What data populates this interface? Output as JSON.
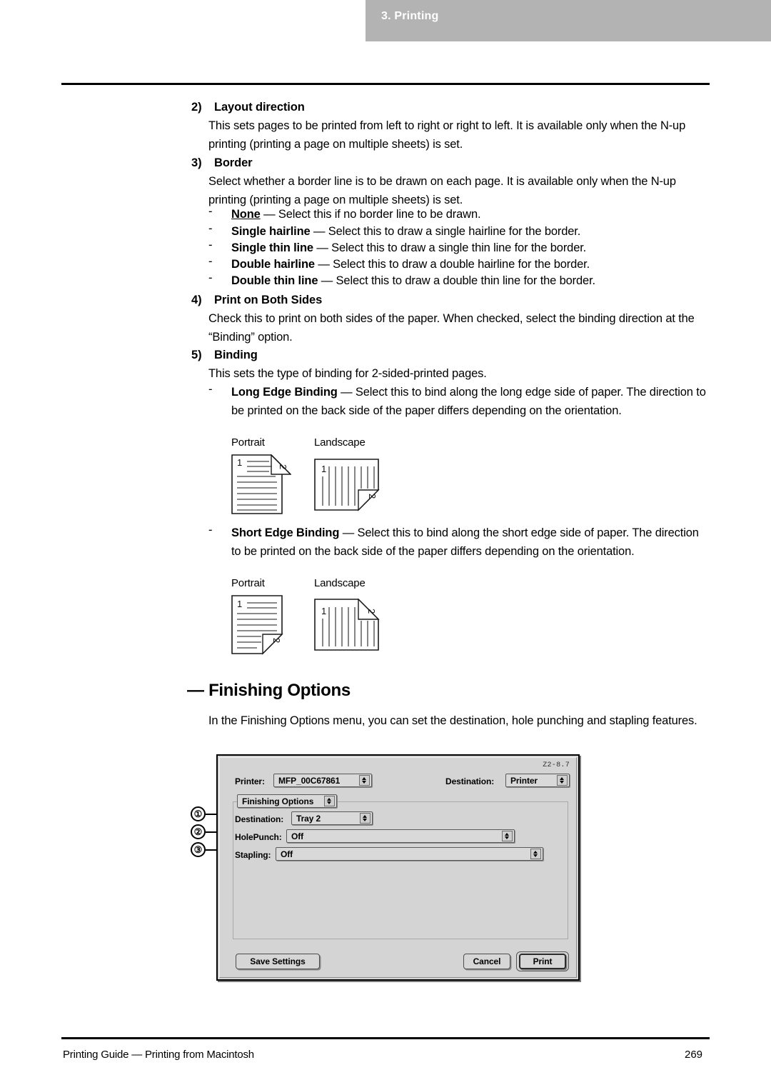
{
  "header": {
    "chapter_title": "3. Printing"
  },
  "sections": [
    {
      "number": "2)",
      "title": "Layout direction",
      "body": "This sets pages to be printed from left to right or right to left.  It is available only when the N-up printing (printing a page on multiple sheets) is set."
    },
    {
      "number": "3)",
      "title": "Border",
      "body": "Select whether a border line is to be drawn on each page.  It is available only when the N-up printing (printing a page on multiple sheets) is set.",
      "options": [
        {
          "dash": "-",
          "term": "None",
          "underline": true,
          "desc": " — Select this if no border line to be drawn."
        },
        {
          "dash": "-",
          "term": "Single hairline",
          "underline": false,
          "desc": " — Select this to draw a single hairline for the border."
        },
        {
          "dash": "-",
          "term": "Single thin line",
          "underline": false,
          "desc": " — Select this to draw a single thin line for the border."
        },
        {
          "dash": "-",
          "term": "Double hairline",
          "underline": false,
          "desc": " — Select this to draw a double hairline for the border."
        },
        {
          "dash": "-",
          "term": "Double thin line",
          "underline": false,
          "desc": " — Select this to draw a double thin line for the border."
        }
      ]
    },
    {
      "number": "4)",
      "title": "Print on Both Sides",
      "body": "Check this to print on both sides of the paper.  When checked, select the binding direction at the “Binding” option."
    },
    {
      "number": "5)",
      "title": "Binding",
      "body": "This sets the type of binding for 2-sided-printed pages."
    }
  ],
  "binding_options": [
    {
      "dash": "-",
      "term": "Long Edge Binding",
      "desc": " — Select this to bind along the long edge side of paper. The direction to be printed on the back side of the paper differs depending on the orientation.",
      "diagram": {
        "portrait_label": "Portrait",
        "landscape_label": "Landscape",
        "front_number": "1",
        "back_number": "2"
      }
    },
    {
      "dash": "-",
      "term": "Short Edge Binding",
      "desc": " — Select this to bind along the short edge side of paper. The direction to be printed on the back side of the paper differs depending on the orientation.",
      "diagram": {
        "portrait_label": "Portrait",
        "landscape_label": "Landscape",
        "front_number": "1",
        "back_number": "2"
      }
    }
  ],
  "finishing": {
    "heading": "— Finishing Options",
    "intro": "In the Finishing Options menu, you can set the destination, hole punching and stapling features."
  },
  "dialog": {
    "version": "Z2-8.7",
    "printer_label": "Printer:",
    "printer_value": "MFP_00C67861",
    "destination_top_label": "Destination:",
    "destination_top_value": "Printer",
    "pane_popup_value": "Finishing Options",
    "rows": [
      {
        "callout": "①",
        "label": "Destination:",
        "value": "Tray 2"
      },
      {
        "callout": "②",
        "label": "HolePunch:",
        "value": "Off"
      },
      {
        "callout": "③",
        "label": "Stapling:",
        "value": "Off"
      }
    ],
    "save_settings_label": "Save Settings",
    "cancel_label": "Cancel",
    "print_label": "Print"
  },
  "footer": {
    "left": "Printing Guide — Printing from Macintosh",
    "page": "269"
  },
  "colors": {
    "header_band": "#b3b3b3",
    "dialog_face": "#d4d4d4"
  }
}
